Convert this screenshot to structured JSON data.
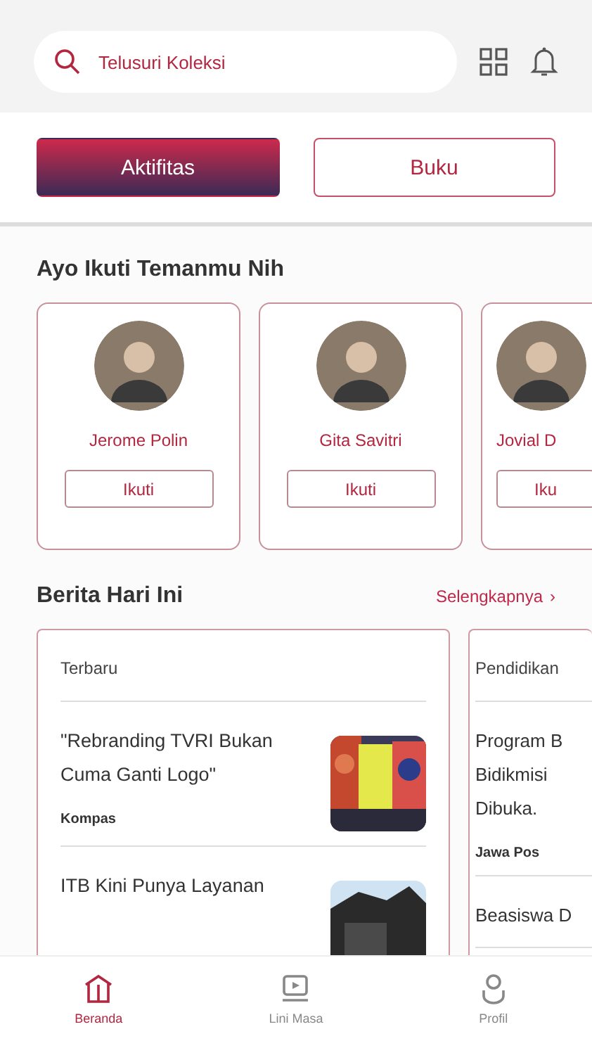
{
  "search": {
    "placeholder": "Telusuri Koleksi"
  },
  "tabs": [
    {
      "label": "Aktifitas",
      "selected": true
    },
    {
      "label": "Buku",
      "selected": false
    }
  ],
  "friends": {
    "title": "Ayo Ikuti Temanmu Nih",
    "people": [
      {
        "name": "Jerome Polin",
        "button": "Ikuti",
        "partial": false
      },
      {
        "name": "Gita Savitri",
        "button": "Ikuti",
        "partial": false
      },
      {
        "name": "Jovial D",
        "button": "Iku",
        "partial": true
      }
    ]
  },
  "news": {
    "title": "Berita Hari Ini",
    "more": "Selengkapnya",
    "more_arrow": "›",
    "columns": [
      {
        "category": "Terbaru",
        "partial": false,
        "articles": [
          {
            "headline": "\"Rebranding TVRI Bukan Cuma Ganti Logo\"",
            "source": "Kompas",
            "kind": "picture"
          },
          {
            "headline": "ITB Kini Punya Layanan",
            "kind": "picture"
          }
        ]
      },
      {
        "category": "Pendidikan",
        "partial": true,
        "articles": [
          {
            "headline": "Program B Bidikmisi Dibuka.",
            "source": "Jawa Pos"
          },
          {
            "headline": "Beasiswa D"
          }
        ]
      }
    ]
  },
  "nav": [
    {
      "label": "Beranda",
      "kind": "home",
      "selected": true
    },
    {
      "label": "Lini Masa",
      "kind": "video",
      "selected": false
    },
    {
      "label": "Profil",
      "kind": "person",
      "selected": false
    }
  ]
}
